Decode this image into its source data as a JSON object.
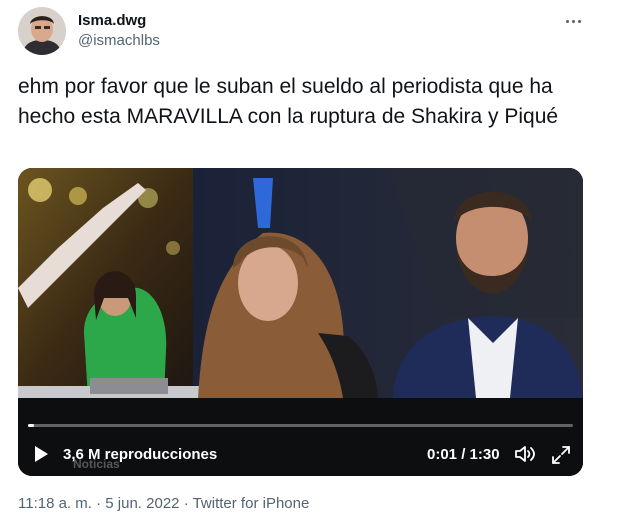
{
  "author": {
    "display_name": "Isma.dwg",
    "handle": "@ismachlbs"
  },
  "tweet": {
    "text": "ehm por favor que le suban el sueldo al periodista que ha hecho esta MARAVILLA con la ruptura de Shakira y Piqué"
  },
  "video": {
    "views": "3,6 M reproducciones",
    "time": "0:01 / 1:30",
    "progress": 0.011,
    "watermark": "Noticias"
  },
  "meta": {
    "time": "11:18 a. m.",
    "separator": "·",
    "date": "5 jun. 2022",
    "source": "Twitter for iPhone"
  },
  "icons": {
    "more": "more-dots-icon",
    "play": "play-icon",
    "volume": "volume-icon",
    "fullscreen": "fullscreen-icon"
  }
}
